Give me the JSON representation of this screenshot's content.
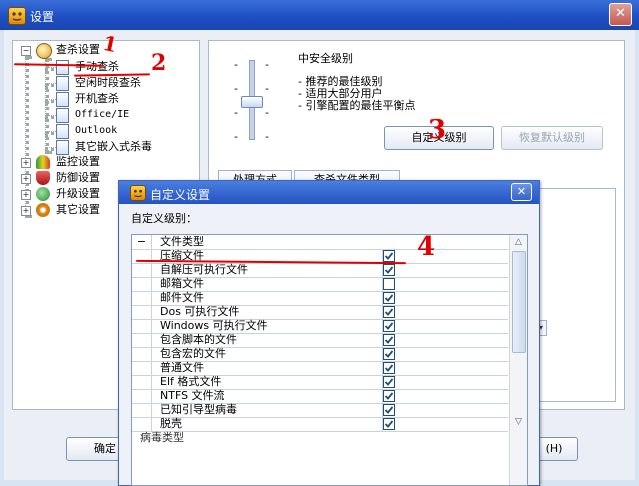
{
  "window": {
    "title": "设置",
    "close": "✕"
  },
  "tree": {
    "items": [
      {
        "label": "查杀设置",
        "icon": "magnifier-icon",
        "expander": "−"
      },
      {
        "label": "手动查杀",
        "icon": "page-icon"
      },
      {
        "label": "空闲时段查杀",
        "icon": "page-icon"
      },
      {
        "label": "开机查杀",
        "icon": "page-icon"
      },
      {
        "label": "Office/IE",
        "icon": "page-icon"
      },
      {
        "label": "Outlook",
        "icon": "page-icon"
      },
      {
        "label": "其它嵌入式杀毒",
        "icon": "page-icon"
      },
      {
        "label": "监控设置",
        "icon": "umbrella-icon",
        "expander": "+"
      },
      {
        "label": "防御设置",
        "icon": "shield-icon",
        "expander": "+"
      },
      {
        "label": "升级设置",
        "icon": "update-icon",
        "expander": "+"
      },
      {
        "label": "其它设置",
        "icon": "gear-icon",
        "expander": "+"
      }
    ]
  },
  "level": {
    "title": "中安全级别",
    "bullets": [
      "- 推荐的最佳级别",
      "- 适用大部分用户",
      "- 引擎配置的最佳平衡点"
    ],
    "ticks": [
      "-",
      "-",
      "-",
      "-"
    ],
    "slider_level": 2,
    "custom_button": "自定义级别",
    "restore_button": "恢复默认级别"
  },
  "tabs": [
    "处理方式",
    "查杀文件类型"
  ],
  "bottom": {
    "ok_label": "确定",
    "help_label": "(H)"
  },
  "dialog": {
    "title": "自定义设置",
    "subtitle": "自定义级别：",
    "group_expander": "−",
    "group_label": "文件类型",
    "rows": [
      {
        "label": "压缩文件",
        "checked": true
      },
      {
        "label": "自解压可执行文件",
        "checked": true
      },
      {
        "label": "邮箱文件",
        "checked": false
      },
      {
        "label": "邮件文件",
        "checked": true
      },
      {
        "label": "Dos 可执行文件",
        "checked": true
      },
      {
        "label": "Windows 可执行文件",
        "checked": true
      },
      {
        "label": "包含脚本的文件",
        "checked": true
      },
      {
        "label": "包含宏的文件",
        "checked": true
      },
      {
        "label": "普通文件",
        "checked": true
      },
      {
        "label": "Elf 格式文件",
        "checked": true
      },
      {
        "label": "NTFS 文件流",
        "checked": true
      },
      {
        "label": "已知引导型病毒",
        "checked": true
      },
      {
        "label": "脱壳",
        "checked": true
      }
    ],
    "cut_row": "病毒类型"
  },
  "annotations": [
    "1",
    "2",
    "3",
    "4"
  ],
  "colors": {
    "title_blue": "#1f4fc4",
    "annotation_red": "#e00000",
    "check": "#1c4d7c"
  }
}
